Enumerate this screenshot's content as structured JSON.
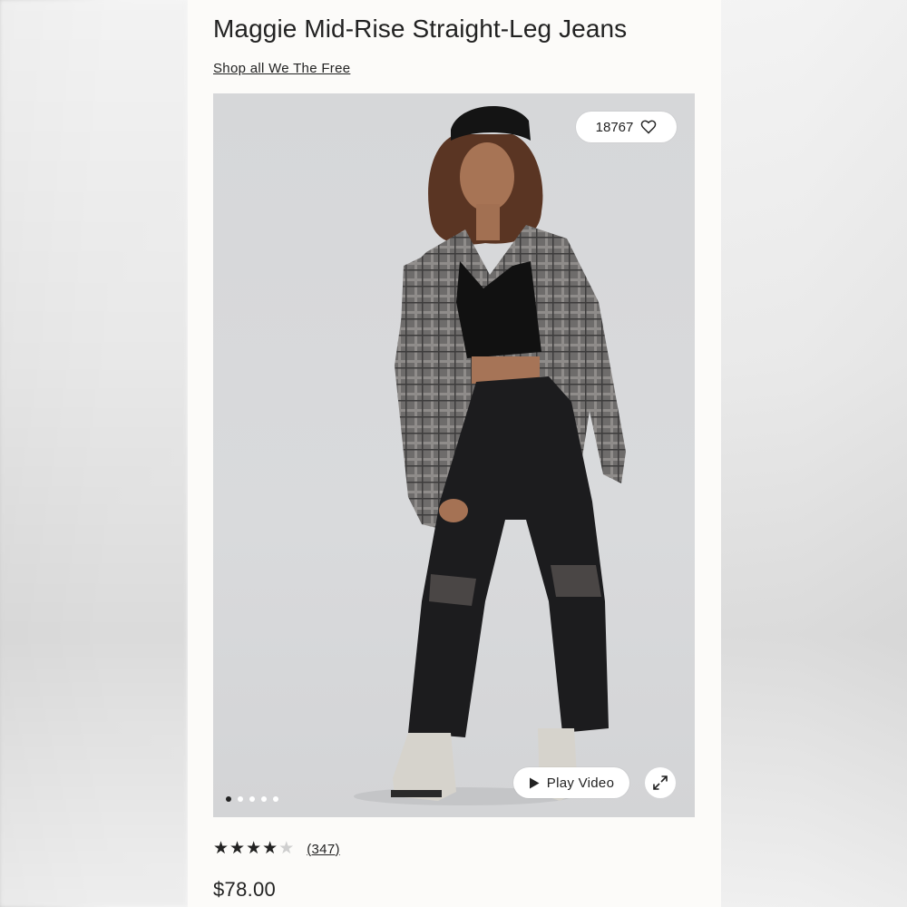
{
  "product": {
    "title": "Maggie Mid-Rise Straight-Leg Jeans",
    "shop_link_label": "Shop all We The Free",
    "favorites_count": "18767",
    "play_video_label": "Play Video",
    "rating": {
      "value": 4,
      "max": 5
    },
    "review_count_label": "(347)",
    "price": "$78.00"
  },
  "gallery": {
    "total_images": 5,
    "active_index": 0
  },
  "icons": {
    "favorite": "heart-outline-icon",
    "play": "play-icon",
    "expand": "expand-icon",
    "star_filled": "star-filled-icon",
    "star_empty": "star-empty-icon"
  },
  "colors": {
    "text": "#222222",
    "card_bg": "#fcfbf9",
    "hero_bg": "#d8d9db",
    "star_empty": "#cfcfcf"
  }
}
